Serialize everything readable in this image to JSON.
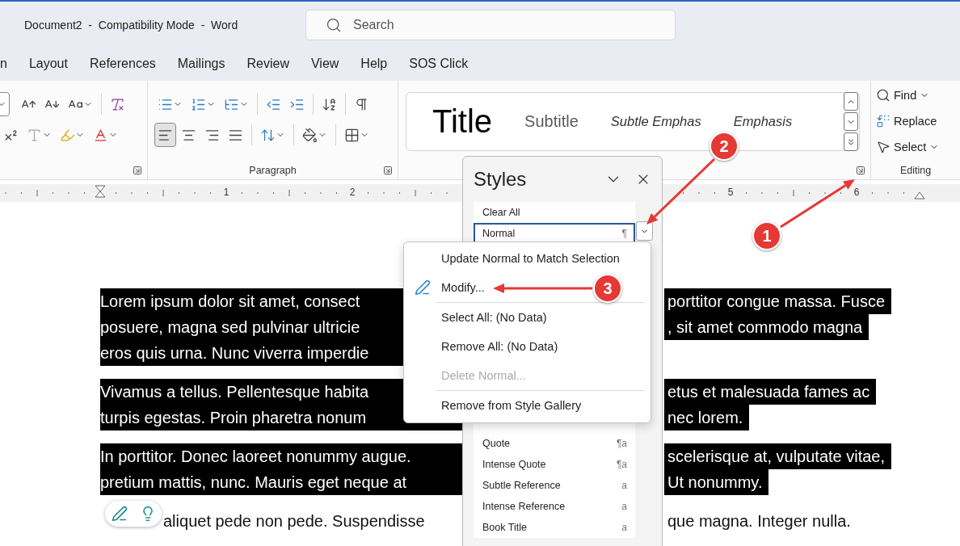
{
  "window": {
    "title": "Document2  -  Compatibility Mode  -  Word"
  },
  "search": {
    "placeholder": "Search"
  },
  "tabs": [
    {
      "label": "n",
      "selected": false
    },
    {
      "label": "Layout",
      "selected": false
    },
    {
      "label": "References",
      "selected": false
    },
    {
      "label": "Mailings",
      "selected": false
    },
    {
      "label": "Review",
      "selected": false
    },
    {
      "label": "View",
      "selected": false
    },
    {
      "label": "Help",
      "selected": false
    },
    {
      "label": "SOS Click",
      "selected": false
    }
  ],
  "ribbon": {
    "paragraph_group": {
      "label": "Paragraph",
      "alignments": [
        {
          "kind": "left",
          "selected": true
        },
        {
          "kind": "center",
          "selected": false
        },
        {
          "kind": "right",
          "selected": false
        },
        {
          "kind": "justify",
          "selected": false
        }
      ]
    },
    "styles_gallery": {
      "items": [
        {
          "label": "Title",
          "kind": "title"
        },
        {
          "label": "Subtitle",
          "kind": "subtitle"
        },
        {
          "label": "Subtle Emphas",
          "kind": "subtle_emphasis"
        },
        {
          "label": "Emphasis",
          "kind": "emphasis"
        }
      ]
    },
    "editing_group": {
      "label": "Editing",
      "buttons": [
        {
          "label": "Find",
          "kind": "find"
        },
        {
          "label": "Replace",
          "kind": "replace"
        },
        {
          "label": "Select",
          "kind": "select"
        }
      ]
    }
  },
  "ruler": {
    "numbers": [
      "1",
      "2",
      "5",
      "6"
    ]
  },
  "document": {
    "paragraphs": [
      {
        "highlighted": true,
        "lines": [
          {
            "left": "Lorem ipsum dolor sit amet, consect",
            "right": "porttitor congue massa. Fusce"
          },
          {
            "left": "posuere, magna sed pulvinar ultricie",
            "right": ", sit amet commodo magna"
          },
          {
            "left": "eros quis urna. Nunc viverra imperdie"
          }
        ]
      },
      {
        "highlighted": true,
        "lines": [
          {
            "left": "Vivamus a tellus. Pellentesque habita",
            "right": "etus et malesuada fames ac"
          },
          {
            "left": "turpis egestas. Proin pharetra nonum",
            "right": "nec lorem."
          }
        ]
      },
      {
        "highlighted": true,
        "lines": [
          {
            "left": "In porttitor. Donec laoreet nonummy augue.",
            "right": "scelerisque at, vulputate vitae,"
          },
          {
            "left": "pretium mattis, nunc. Mauris eget neque at",
            "right": "Ut nonummy."
          }
        ]
      },
      {
        "highlighted": false,
        "lines": [
          {
            "left": "aliquet pede non pede. Suspendisse",
            "right": "que magna. Integer nulla.",
            "kind": "after_toolbar"
          }
        ]
      }
    ]
  },
  "styles_pane": {
    "title": "Styles",
    "items": [
      {
        "label": "Clear All",
        "selected": false
      },
      {
        "label": "Normal",
        "mark": "¶",
        "selected": true
      },
      {
        "label": "Quote",
        "mark": "¶a",
        "selected": false
      },
      {
        "label": "Intense Quote",
        "mark": "¶a",
        "selected": false
      },
      {
        "label": "Subtle Reference",
        "mark": "a",
        "selected": false
      },
      {
        "label": "Intense Reference",
        "mark": "a",
        "selected": false
      },
      {
        "label": "Book Title",
        "mark": "a",
        "selected": false
      }
    ]
  },
  "context_menu": {
    "items": [
      {
        "kind": "item",
        "label": "Update Normal to Match Selection",
        "disabled": false
      },
      {
        "kind": "icon_item",
        "label": "Modify...",
        "disabled": false
      },
      {
        "kind": "separator"
      },
      {
        "kind": "item",
        "label": "Select All: (No Data)",
        "disabled": false
      },
      {
        "kind": "item",
        "label": "Remove All: (No Data)",
        "disabled": false
      },
      {
        "kind": "item",
        "label": "Delete Normal...",
        "disabled": true
      },
      {
        "kind": "separator"
      },
      {
        "kind": "item",
        "label": "Remove from Style Gallery",
        "disabled": false
      }
    ]
  },
  "annotations": [
    {
      "number": "1"
    },
    {
      "number": "2"
    },
    {
      "number": "3"
    }
  ]
}
